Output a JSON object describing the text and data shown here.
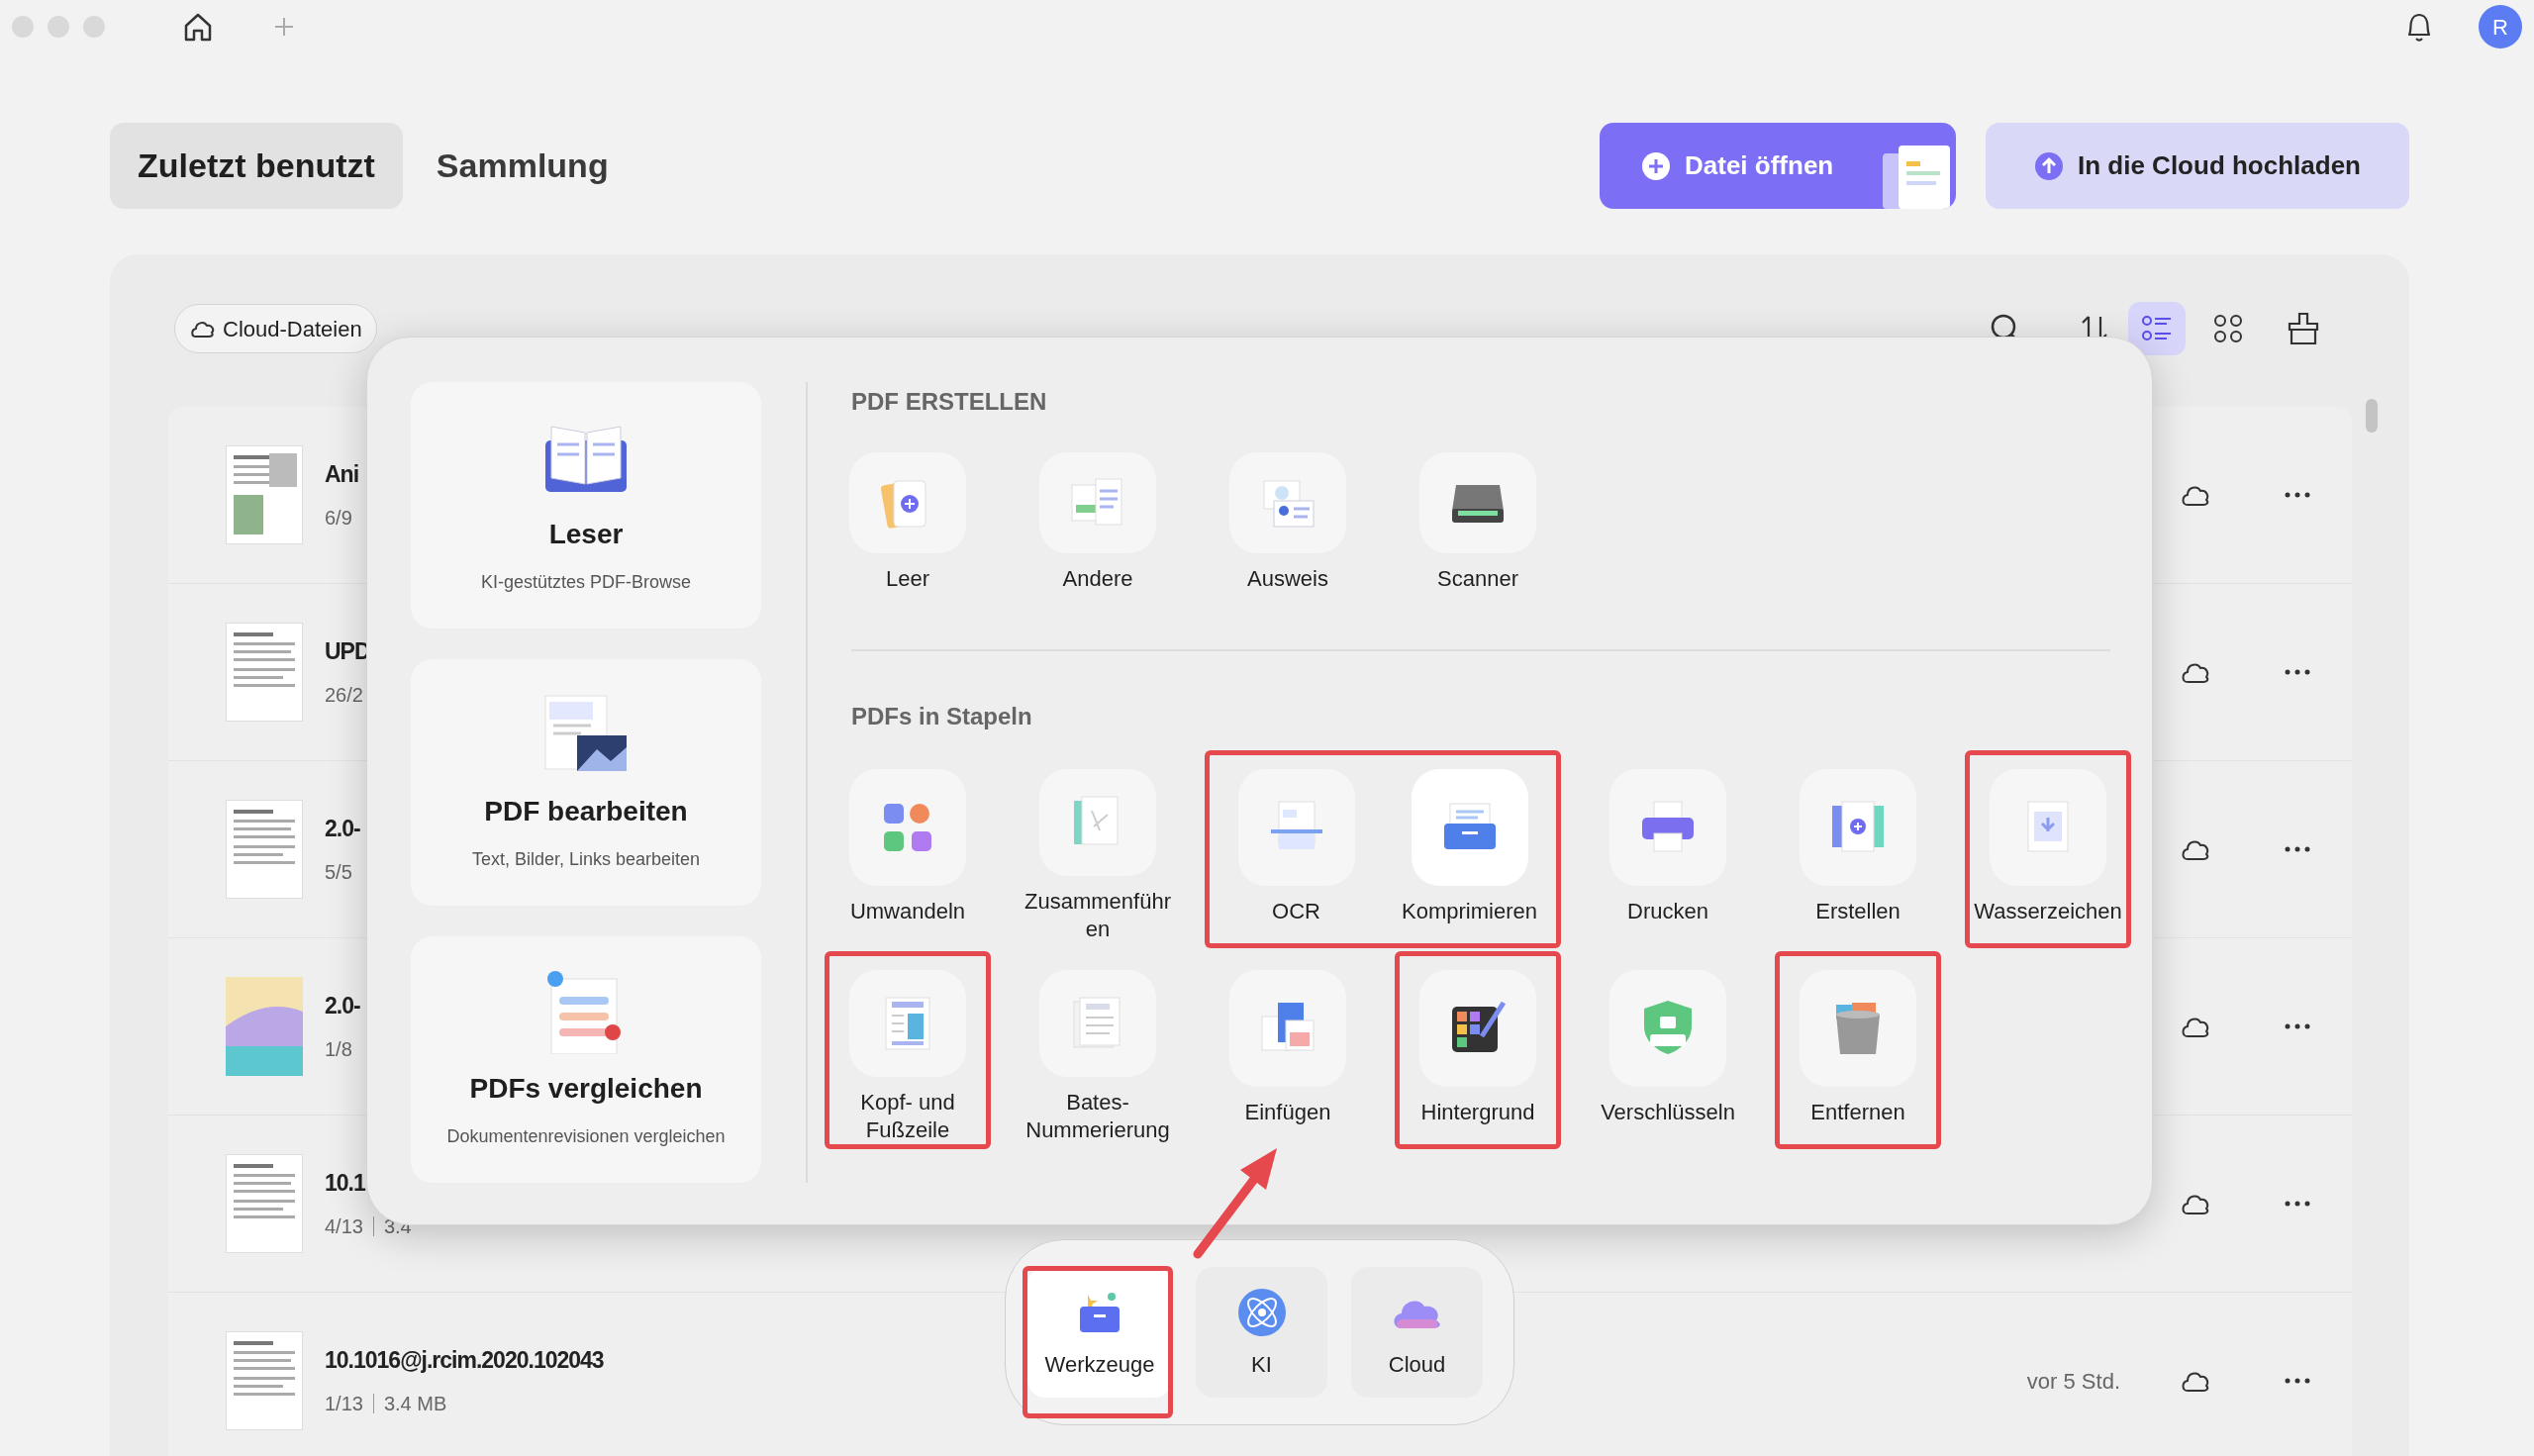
{
  "tabs": [
    {
      "label": "Zuletzt benutzt",
      "selected": true
    },
    {
      "label": "Sammlung",
      "selected": false
    }
  ],
  "actions": [
    {
      "label": "Datei öffnen",
      "kind": "primary"
    },
    {
      "label": "In die Cloud hochladen",
      "kind": "secondary"
    }
  ],
  "avatar": "R",
  "cloud_chip": "Cloud-Dateien",
  "view_modes": [
    {
      "kind": "list",
      "selected": true
    },
    {
      "kind": "grid",
      "selected": false
    }
  ],
  "files": [
    {
      "title": "Ani",
      "pages": "6/9"
    },
    {
      "title": "UPD",
      "pages": "26/2"
    },
    {
      "title": "2.0-",
      "pages": "5/5"
    },
    {
      "title": "2.0-",
      "pages": "1/8"
    },
    {
      "title": "10.1",
      "pages": "4/13",
      "size": "3.4"
    },
    {
      "title": "10.1016@j.rcim.2020.102043",
      "pages": "1/13",
      "size": "3.4 MB",
      "time": "vor 5 Std."
    }
  ],
  "tools_panel": {
    "cards": [
      {
        "title": "Leser",
        "subtitle": "KI-gestütztes PDF-Browse"
      },
      {
        "title": "PDF bearbeiten",
        "subtitle": "Text, Bilder, Links bearbeiten"
      },
      {
        "title": "PDFs vergleichen",
        "subtitle": "Dokumentenrevisionen vergleichen"
      }
    ],
    "sections": [
      {
        "title": "PDF ERSTELLEN",
        "rows": [
          [
            {
              "label": "Leer",
              "highlighted": false
            },
            {
              "label": "Andere",
              "highlighted": false
            },
            {
              "label": "Ausweis",
              "highlighted": false
            },
            {
              "label": "Scanner",
              "highlighted": false
            }
          ]
        ]
      },
      {
        "title": "PDFs in Stapeln",
        "rows": [
          [
            {
              "label": "Umwandeln",
              "highlighted": false
            },
            {
              "label": "Zusammenführen",
              "highlighted": false
            },
            {
              "label": "OCR",
              "highlighted": true
            },
            {
              "label": "Komprimieren",
              "highlighted": true
            },
            {
              "label": "Drucken",
              "highlighted": false
            },
            {
              "label": "Erstellen",
              "highlighted": false
            },
            {
              "label": "Wasserzeichen",
              "highlighted": true
            }
          ],
          [
            {
              "label": "Kopf- und Fußzeile",
              "highlighted": true
            },
            {
              "label": "Bates-Nummerierung",
              "highlighted": false
            },
            {
              "label": "Einfügen",
              "highlighted": false
            },
            {
              "label": "Hintergrund",
              "highlighted": true
            },
            {
              "label": "Verschlüsseln",
              "highlighted": false
            },
            {
              "label": "Entfernen",
              "highlighted": true
            }
          ]
        ]
      }
    ]
  },
  "dock": [
    {
      "label": "Werkzeuge",
      "selected": true,
      "highlighted": true
    },
    {
      "label": "KI",
      "selected": false,
      "highlighted": false
    },
    {
      "label": "Cloud",
      "selected": false,
      "highlighted": false
    }
  ],
  "pointer_arrow": true
}
